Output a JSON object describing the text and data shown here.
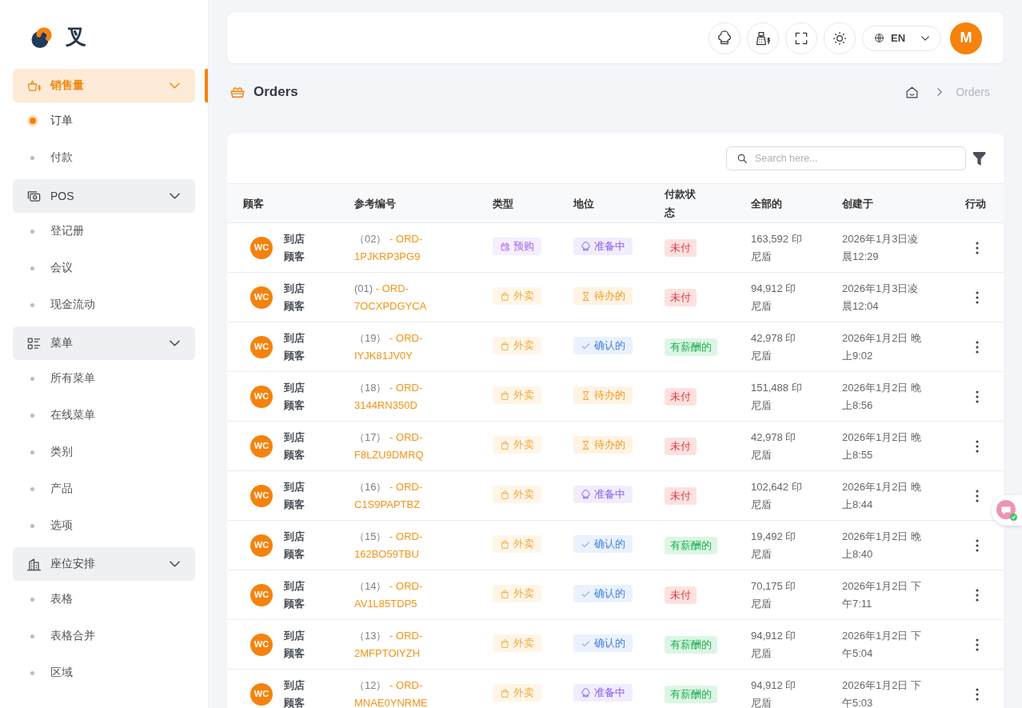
{
  "sidebar": {
    "brand": "叉",
    "groups": [
      {
        "label": "销售量",
        "active": true,
        "expanded": true,
        "items": [
          {
            "label": "订单",
            "selected": true
          },
          {
            "label": "付款",
            "selected": false
          }
        ]
      },
      {
        "label": "POS",
        "active": false,
        "expanded": true,
        "items": [
          {
            "label": "登记册",
            "selected": false
          },
          {
            "label": "会议",
            "selected": false
          },
          {
            "label": "现金流动",
            "selected": false
          }
        ]
      },
      {
        "label": "菜单",
        "active": false,
        "expanded": true,
        "items": [
          {
            "label": "所有菜单",
            "selected": false
          },
          {
            "label": "在线菜单",
            "selected": false
          },
          {
            "label": "类别",
            "selected": false
          },
          {
            "label": "产品",
            "selected": false
          },
          {
            "label": "选项",
            "selected": false
          }
        ]
      },
      {
        "label": "座位安排",
        "active": false,
        "expanded": true,
        "items": [
          {
            "label": "表格",
            "selected": false
          },
          {
            "label": "表格合并",
            "selected": false
          },
          {
            "label": "区域",
            "selected": false
          }
        ]
      }
    ]
  },
  "topbar": {
    "language": "EN",
    "avatar_initial": "M"
  },
  "page": {
    "title": "Orders",
    "breadcrumb": [
      "Orders"
    ]
  },
  "table": {
    "search": {
      "placeholder": "Search here..."
    },
    "columns": [
      "顾客",
      "参考编号",
      "类型",
      "地位",
      "付款状态",
      "全部的",
      "创建于",
      "行动"
    ],
    "rows": [
      {
        "initials": "WC",
        "customer": "到店顾客",
        "ref_index": "（02）",
        "ref_code": "- ORD-1PJKRP3PG9",
        "type": {
          "label": "预购",
          "kind": "preorder"
        },
        "status": {
          "label": "准备中",
          "kind": "preparing"
        },
        "payment": {
          "label": "未付",
          "kind": "unpaid"
        },
        "total": "163,592 印尼盾",
        "created": "2026年1月3日凌晨12:29"
      },
      {
        "initials": "WC",
        "customer": "到店顾客",
        "ref_index": "(01)",
        "ref_code": "- ORD-7OCXPDGYCA",
        "type": {
          "label": "外卖",
          "kind": "takeaway"
        },
        "status": {
          "label": "待办的",
          "kind": "pending"
        },
        "payment": {
          "label": "未付",
          "kind": "unpaid"
        },
        "total": "94,912 印尼盾",
        "created": "2026年1月3日凌晨12:04"
      },
      {
        "initials": "WC",
        "customer": "到店顾客",
        "ref_index": "（19）",
        "ref_code": "- ORD-IYJK81JV0Y",
        "type": {
          "label": "外卖",
          "kind": "takeaway"
        },
        "status": {
          "label": "确认的",
          "kind": "confirmed"
        },
        "payment": {
          "label": "有薪酬的",
          "kind": "paid"
        },
        "total": "42,978 印尼盾",
        "created": "2026年1月2日 晚上9:02"
      },
      {
        "initials": "WC",
        "customer": "到店顾客",
        "ref_index": "（18）",
        "ref_code": "- ORD-3144RN350D",
        "type": {
          "label": "外卖",
          "kind": "takeaway"
        },
        "status": {
          "label": "待办的",
          "kind": "pending"
        },
        "payment": {
          "label": "未付",
          "kind": "unpaid"
        },
        "total": "151,488 印尼盾",
        "created": "2026年1月2日 晚上8:56"
      },
      {
        "initials": "WC",
        "customer": "到店顾客",
        "ref_index": "（17）",
        "ref_code": "- ORD-F8LZU9DMRQ",
        "type": {
          "label": "外卖",
          "kind": "takeaway"
        },
        "status": {
          "label": "待办的",
          "kind": "pending"
        },
        "payment": {
          "label": "未付",
          "kind": "unpaid"
        },
        "total": "42,978 印尼盾",
        "created": "2026年1月2日 晚上8:55"
      },
      {
        "initials": "WC",
        "customer": "到店顾客",
        "ref_index": "（16）",
        "ref_code": "- ORD-C1S9PAPTBZ",
        "type": {
          "label": "外卖",
          "kind": "takeaway"
        },
        "status": {
          "label": "准备中",
          "kind": "preparing"
        },
        "payment": {
          "label": "未付",
          "kind": "unpaid"
        },
        "total": "102,642 印尼盾",
        "created": "2026年1月2日 晚上8:44"
      },
      {
        "initials": "WC",
        "customer": "到店顾客",
        "ref_index": "（15）",
        "ref_code": "- ORD-162BO59TBU",
        "type": {
          "label": "外卖",
          "kind": "takeaway"
        },
        "status": {
          "label": "确认的",
          "kind": "confirmed"
        },
        "payment": {
          "label": "有薪酬的",
          "kind": "paid"
        },
        "total": "19,492 印尼盾",
        "created": "2026年1月2日 晚上8:40"
      },
      {
        "initials": "WC",
        "customer": "到店顾客",
        "ref_index": "（14）",
        "ref_code": "- ORD-AV1L85TDP5",
        "type": {
          "label": "外卖",
          "kind": "takeaway"
        },
        "status": {
          "label": "确认的",
          "kind": "confirmed"
        },
        "payment": {
          "label": "未付",
          "kind": "unpaid"
        },
        "total": "70,175 印尼盾",
        "created": "2026年1月2日 下午7:11"
      },
      {
        "initials": "WC",
        "customer": "到店顾客",
        "ref_index": "（13）",
        "ref_code": "- ORD-2MFPTOIYZH",
        "type": {
          "label": "外卖",
          "kind": "takeaway"
        },
        "status": {
          "label": "确认的",
          "kind": "confirmed"
        },
        "payment": {
          "label": "有薪酬的",
          "kind": "paid"
        },
        "total": "94,912 印尼盾",
        "created": "2026年1月2日 下午5:04"
      },
      {
        "initials": "WC",
        "customer": "到店顾客",
        "ref_index": "（12）",
        "ref_code": "- ORD-MNAE0YNRME",
        "type": {
          "label": "外卖",
          "kind": "takeaway"
        },
        "status": {
          "label": "准备中",
          "kind": "preparing"
        },
        "payment": {
          "label": "有薪酬的",
          "kind": "paid"
        },
        "total": "94,912 印尼盾",
        "created": "2026年1月2日 下午5:03"
      }
    ]
  }
}
